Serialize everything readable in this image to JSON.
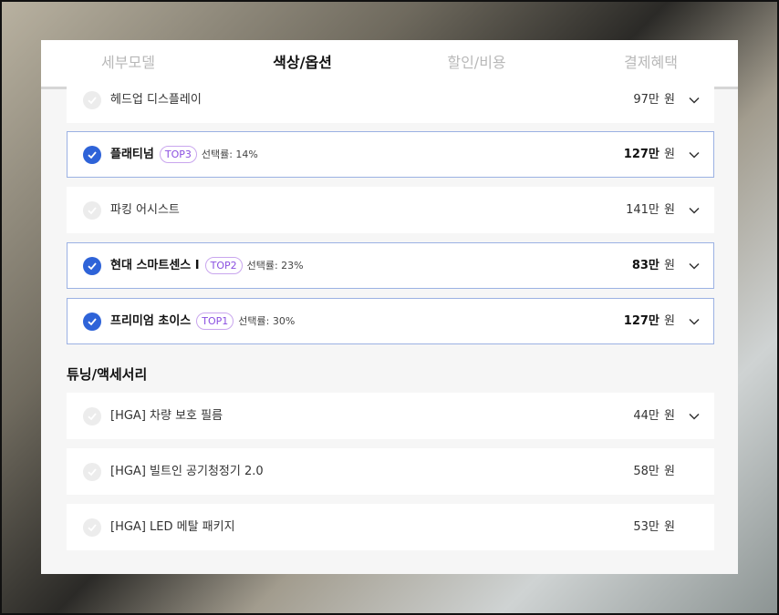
{
  "tabs": [
    {
      "label": "세부모델",
      "active": false
    },
    {
      "label": "색상/옵션",
      "active": true
    },
    {
      "label": "할인/비용",
      "active": false
    },
    {
      "label": "결제혜택",
      "active": false
    }
  ],
  "options": [
    {
      "name": "헤드업 디스플레이",
      "price": "97만",
      "unit": "원",
      "selected": false
    },
    {
      "name": "플래티넘",
      "badge": "TOP3",
      "rate": "선택률: 14%",
      "price": "127만",
      "unit": "원",
      "selected": true
    },
    {
      "name": "파킹 어시스트",
      "price": "141만",
      "unit": "원",
      "selected": false
    },
    {
      "name": "현대 스마트센스 I",
      "badge": "TOP2",
      "rate": "선택률: 23%",
      "price": "83만",
      "unit": "원",
      "selected": true
    },
    {
      "name": "프리미엄 초이스",
      "badge": "TOP1",
      "rate": "선택률: 30%",
      "price": "127만",
      "unit": "원",
      "selected": true
    }
  ],
  "accessory_section": {
    "title": "튜닝/액세서리",
    "items": [
      {
        "name": "[HGA] 차량 보호 필름",
        "price": "44만",
        "unit": "원",
        "selected": false
      },
      {
        "name": "[HGA] 빌트인 공기청정기 2.0",
        "price": "58만",
        "unit": "원",
        "selected": false
      },
      {
        "name": "[HGA] LED 메탈 패키지",
        "price": "53만",
        "unit": "원",
        "selected": false
      }
    ]
  },
  "colors": {
    "accent": "#2e63d8",
    "badge": "#8a4fe0"
  }
}
